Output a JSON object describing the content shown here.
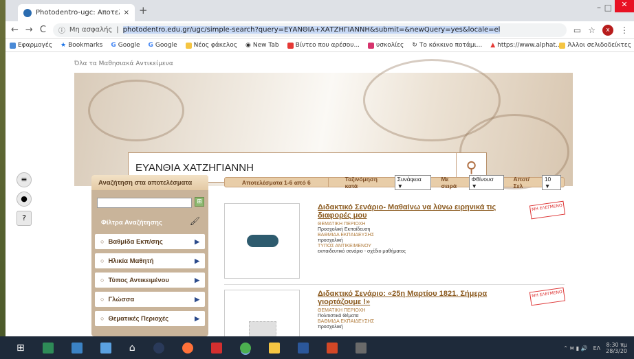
{
  "browser": {
    "tab_title": "Photodentro-ugc: Αποτελέσματ",
    "tab_close": "×",
    "new_tab": "+",
    "security_label": "Μη ασφαλής",
    "url": "photodentro.edu.gr/ugc/simple-search?query=ΕΥΑΝΘΙΑ+ΧΑΤΖΗΓΙΑΝΝΗ&submit=&newQuery=yes&locale=el",
    "profile_initial": "x",
    "bookmarks": [
      "Εφαρμογές",
      "Bookmarks",
      "Google",
      "Google",
      "Νέος φάκελος",
      "New Tab",
      "Βίντεο που αρέσου...",
      "υσκολίες",
      "Το κόκκινο ποτάμι...",
      "https://www.alphat..."
    ],
    "other_bookmarks": "Άλλοι σελιδοδείκτες"
  },
  "page": {
    "breadcrumb": "Όλα τα Μαθησιακά Αντικείμενα",
    "search_query": "ΕΥΑΝΘΙΑ ΧΑΤΖΗΓΙΑΝΝΗ",
    "sidebar": {
      "search_in_results": "Αναζήτηση στα αποτελέσματα",
      "filters_title": "Φίλτρα Αναζήτησης",
      "items": [
        {
          "label": "Βαθμίδα Εκπ/σης"
        },
        {
          "label": "Ηλικία Μαθητή"
        },
        {
          "label": "Τύπος Αντικειμένου"
        },
        {
          "label": "Γλώσσα"
        },
        {
          "label": "Θεματικές Περιοχές"
        }
      ]
    },
    "results_bar": {
      "count": "Αποτελέσματα 1-6 από 6",
      "sort_label": "Ταξινόμηση κατά",
      "sort_value": "Συνάφεια ▼",
      "order_label": "Με σειρά",
      "order_value": "Φθίνουσ ▼",
      "per_page_label": "Αποτ/Σελ",
      "per_page_value": "10 ▼"
    },
    "results": [
      {
        "title": "Διδακτικό Σενάριο- Μαθαίνω να λύνω ειρηνικά τις διαφορές μου",
        "subject_key": "ΘΕΜΑΤΙΚΗ ΠΕΡΙΟΧΗ",
        "subject_val": "Προσχολική Εκπαίδευση",
        "level_key": "ΒΑΘΜΙΔΑ ΕΚΠΑΙΔΕΥΣΗΣ",
        "level_val": "προσχολική",
        "type_key": "ΤΥΠΟΣ ΑΝΤΙΚΕΙΜΕΝΟΥ",
        "type_val": "εκπαιδευτικό σενάριο - σχέδιο μαθήματος",
        "stamp": "ΜΗ ΕΛΕΓΜΕΝΟ"
      },
      {
        "title": "Διδακτικό Σενάριο: «25η Μαρτίου 1821. Σήμερα γιορτάζουμε !»",
        "subject_key": "ΘΕΜΑΤΙΚΗ ΠΕΡΙΟΧΗ",
        "subject_val": "Πολιτιστικά Θέματα",
        "level_key": "ΒΑΘΜΙΔΑ ΕΚΠΑΙΔΕΥΣΗΣ",
        "level_val": "προσχολική",
        "stamp": "ΜΗ ΕΛΕΓΜΕΝΟ"
      }
    ]
  },
  "taskbar": {
    "time": "8:30 πμ",
    "date": "28/3/20",
    "lang": "ΕΛ"
  },
  "colors": {
    "accent": "#8b5a1f",
    "panel": "#c9b49a",
    "taskbar": "#1e2a3a"
  }
}
